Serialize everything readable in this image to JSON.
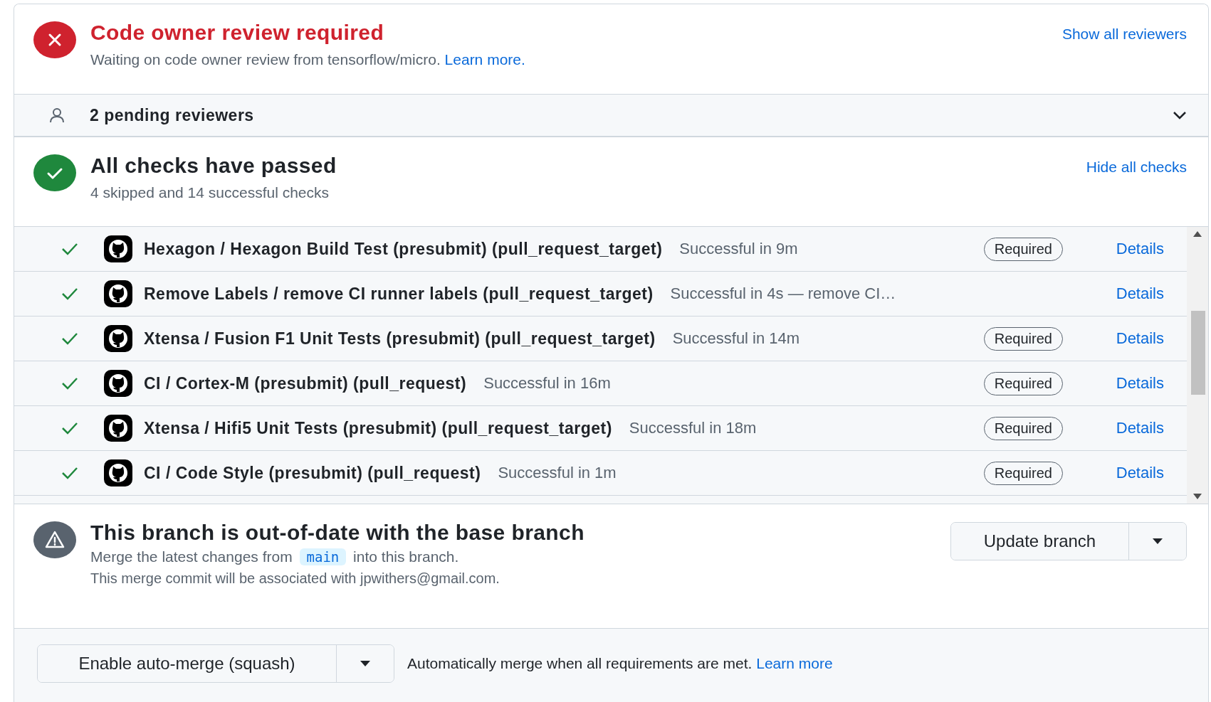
{
  "review": {
    "kind": "failed",
    "title": "Code owner review required",
    "description": "Waiting on code owner review from tensorflow/micro.",
    "learn_more": "Learn more.",
    "link": "Show all reviewers"
  },
  "reviewers": {
    "label": "2 pending reviewers",
    "expanded": false
  },
  "checks": {
    "kind": "passed",
    "title": "All checks have passed",
    "summary": "4 skipped and 14 successful checks",
    "link": "Hide all checks",
    "items": [
      {
        "name": "Hexagon / Hexagon Build Test (presubmit) (pull_request_target)",
        "status": "Successful in 9m",
        "badge": "Required",
        "details": "Details"
      },
      {
        "name": "Remove Labels / remove CI runner labels (pull_request_target)",
        "status": "Successful in 4s — remove CI…",
        "details": "Details"
      },
      {
        "name": "Xtensa / Fusion F1 Unit Tests (presubmit) (pull_request_target)",
        "status": "Successful in 14m",
        "badge": "Required",
        "details": "Details"
      },
      {
        "name": "CI / Cortex-M (presubmit) (pull_request)",
        "status": "Successful in 16m",
        "badge": "Required",
        "details": "Details"
      },
      {
        "name": "Xtensa / Hifi5 Unit Tests (presubmit) (pull_request_target)",
        "status": "Successful in 18m",
        "badge": "Required",
        "details": "Details"
      },
      {
        "name": "CI / Code Style (presubmit) (pull_request)",
        "status": "Successful in 1m",
        "badge": "Required",
        "details": "Details"
      }
    ]
  },
  "branch": {
    "kind": "warning",
    "title": "This branch is out-of-date with the base branch",
    "merge_before": "Merge the latest changes from",
    "branch_name": "main",
    "merge_after": "into this branch.",
    "commit_note": "This merge commit will be associated with jpwithers@gmail.com.",
    "button": "Update branch"
  },
  "merge": {
    "button": "Enable auto-merge (squash)",
    "note": "Automatically merge when all requirements are met.",
    "learn_more": "Learn more"
  }
}
